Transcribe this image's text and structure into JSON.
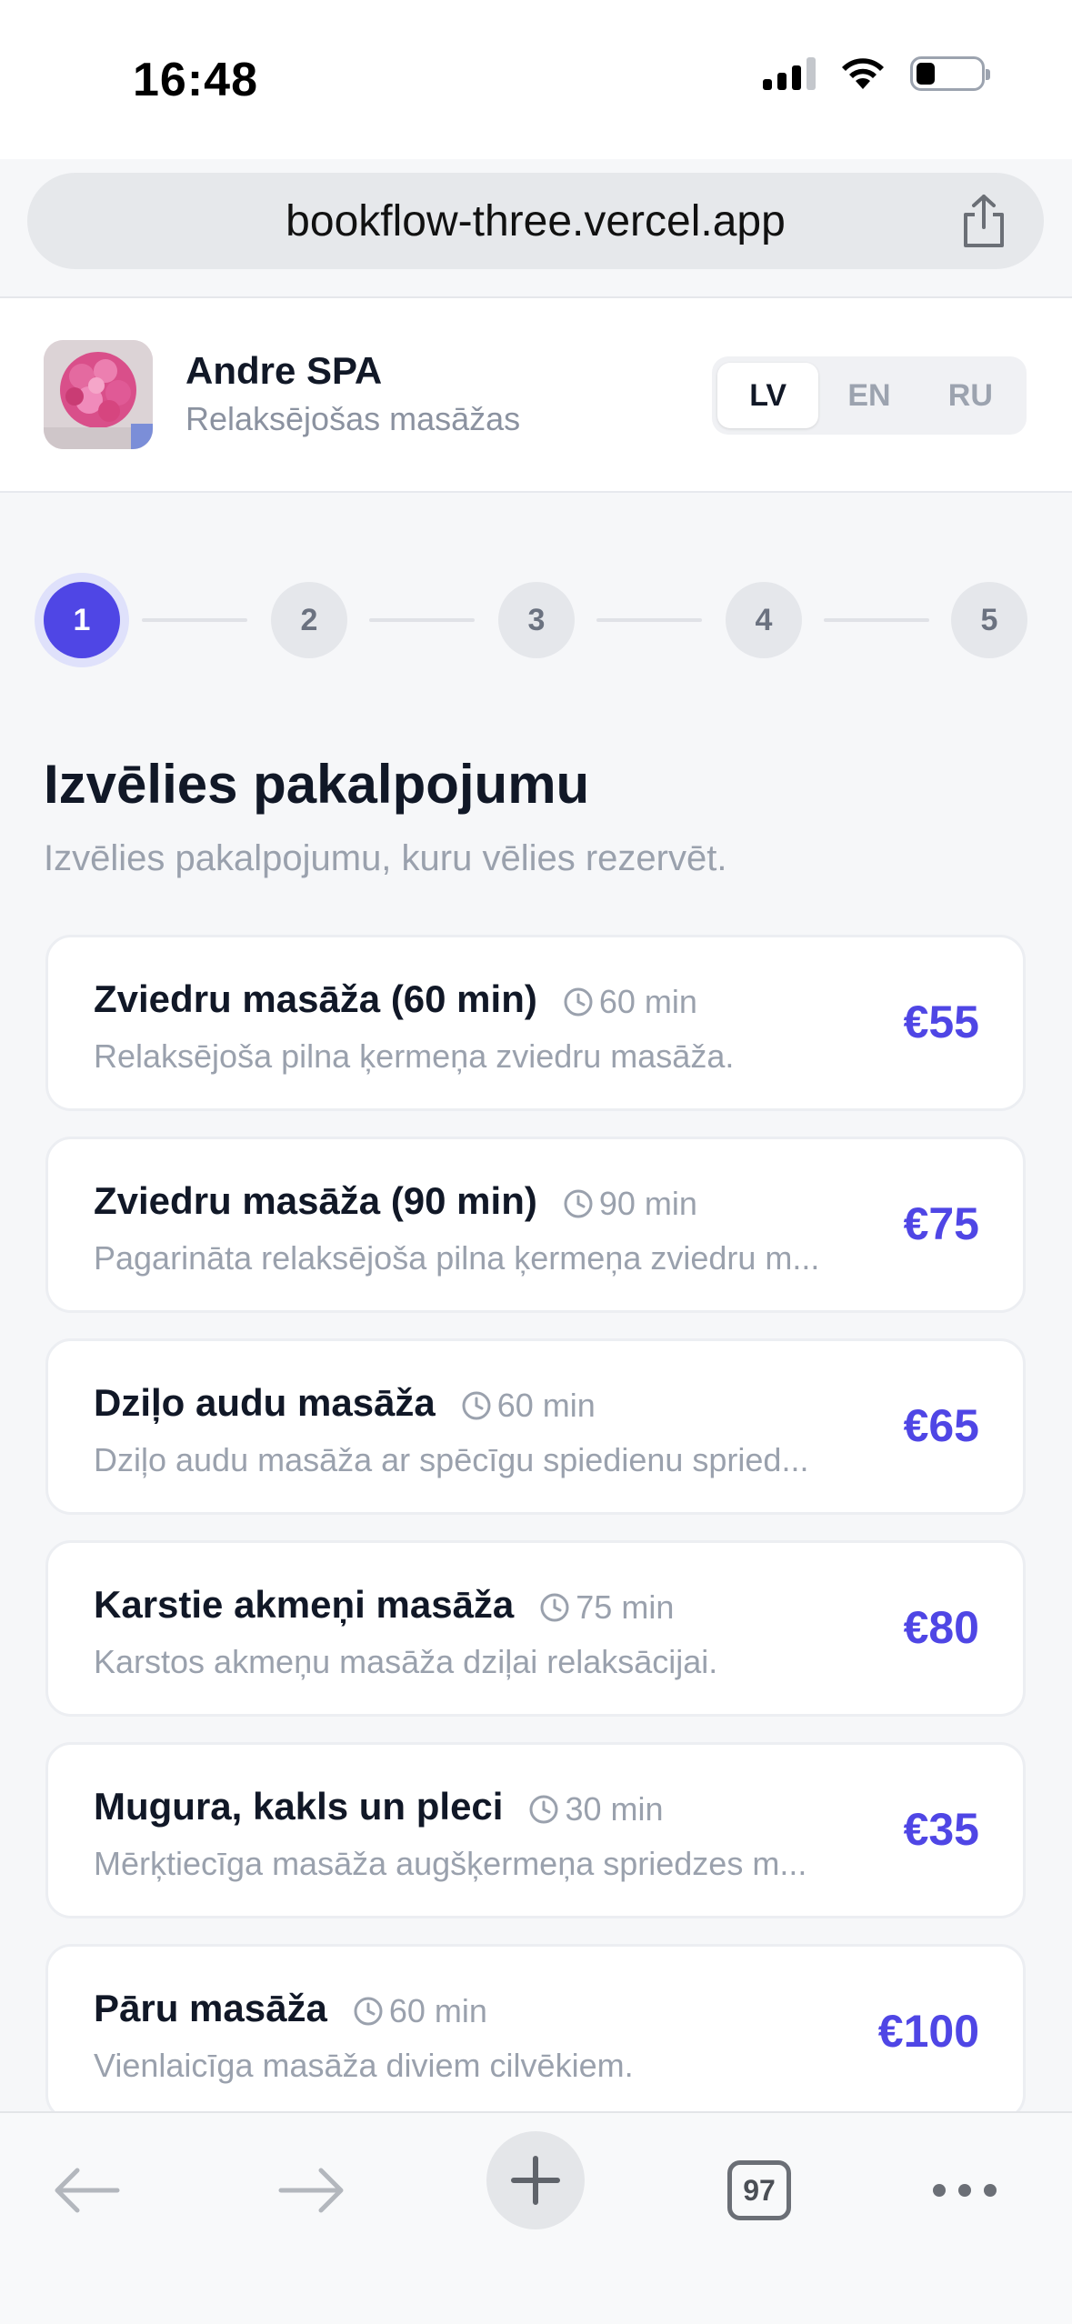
{
  "status_bar": {
    "time": "16:48"
  },
  "browser": {
    "url": "bookflow-three.vercel.app",
    "tab_count": "97"
  },
  "business": {
    "name": "Andre SPA",
    "subtitle": "Relaksējošas masāžas"
  },
  "languages": [
    {
      "code": "LV",
      "active": true
    },
    {
      "code": "EN",
      "active": false
    },
    {
      "code": "RU",
      "active": false
    }
  ],
  "steps": [
    {
      "label": "1",
      "active": true
    },
    {
      "label": "2",
      "active": false
    },
    {
      "label": "3",
      "active": false
    },
    {
      "label": "4",
      "active": false
    },
    {
      "label": "5",
      "active": false
    }
  ],
  "page": {
    "title": "Izvēlies pakalpojumu",
    "subtitle": "Izvēlies pakalpojumu, kuru vēlies rezervēt."
  },
  "services": [
    {
      "name": "Zviedru masāža (60 min)",
      "duration": "60 min",
      "description": "Relaksējoša pilna ķermeņa zviedru masāža.",
      "price": "€55"
    },
    {
      "name": "Zviedru masāža (90 min)",
      "duration": "90 min",
      "description": "Pagarināta relaksējoša pilna ķermeņa zviedru m...",
      "price": "€75"
    },
    {
      "name": "Dziļo audu masāža",
      "duration": "60 min",
      "description": "Dziļo audu masāža ar spēcīgu spiedienu spried...",
      "price": "€65"
    },
    {
      "name": "Karstie akmeņi masāža",
      "duration": "75 min",
      "description": "Karstos akmeņu masāža dziļai relaksācijai.",
      "price": "€80"
    },
    {
      "name": "Mugura, kakls un pleci",
      "duration": "30 min",
      "description": "Mērķtiecīga masāža augšķermeņa spriedzes m...",
      "price": "€35"
    },
    {
      "name": "Pāru masāža",
      "duration": "60 min",
      "description": "Vienlaicīga masāža diviem cilvēkiem.",
      "price": "€100"
    }
  ],
  "colors": {
    "accent": "#4f46e5",
    "accent_ring": "#dfe1fb",
    "muted_text": "#9aa1ad"
  }
}
